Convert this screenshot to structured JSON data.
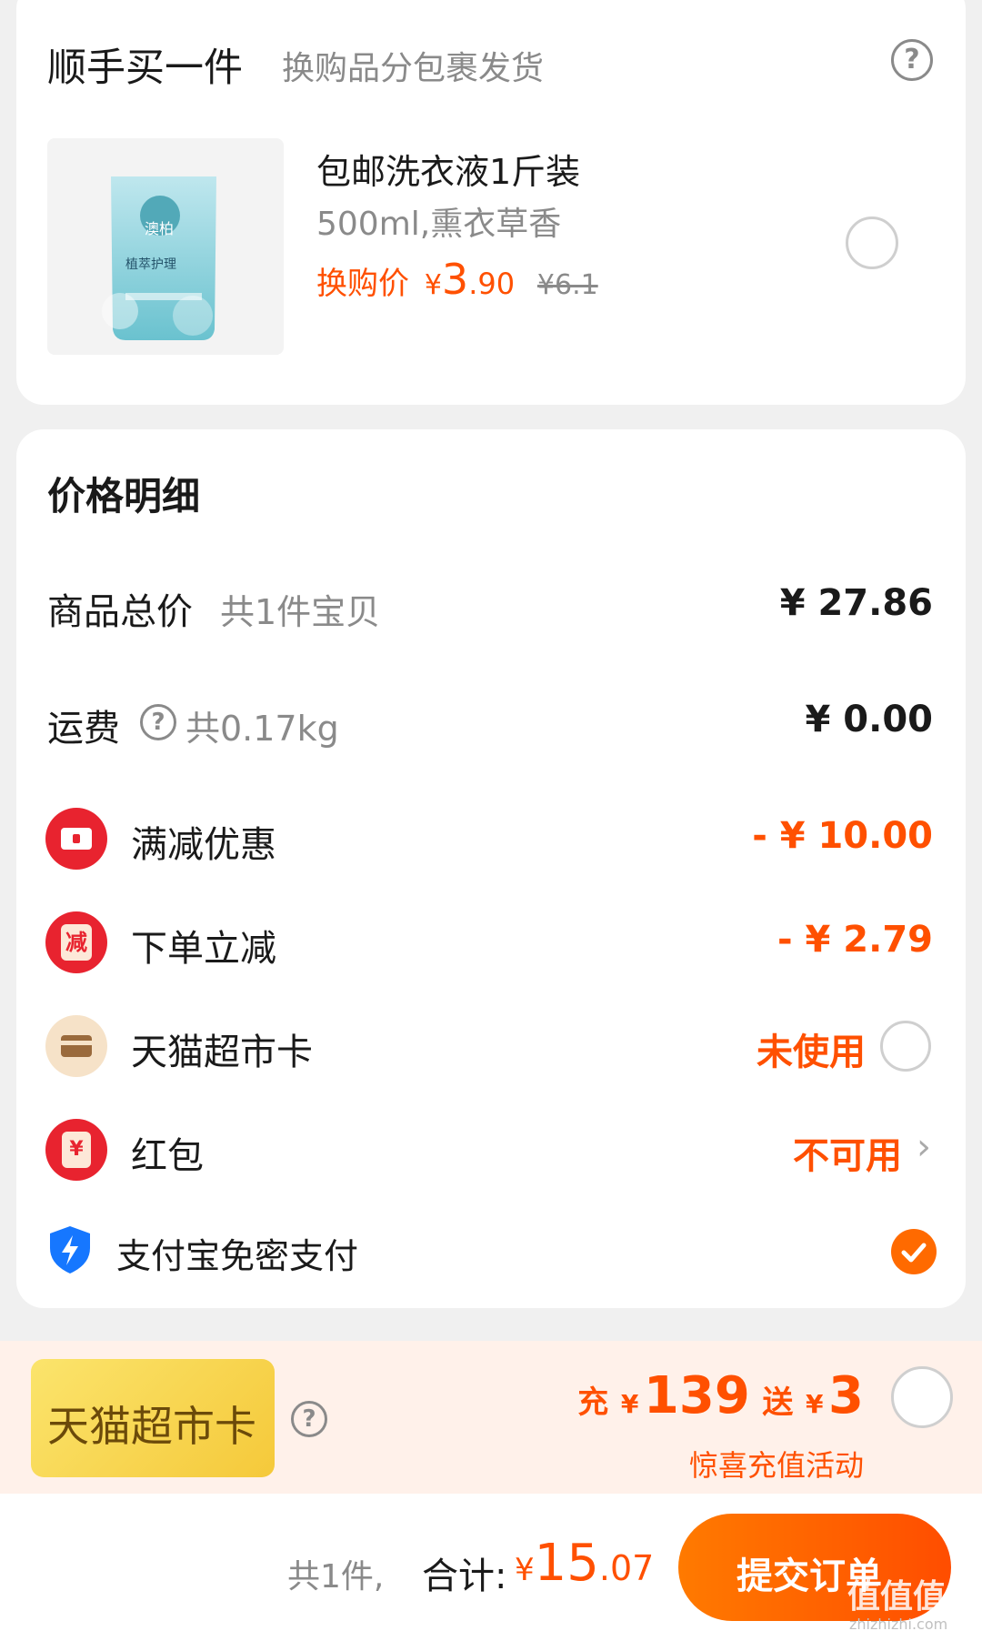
{
  "addon": {
    "title": "顺手买一件",
    "subtitle": "换购品分包裹发货",
    "help_icon": "question-circle-icon",
    "product": {
      "name": "包邮洗衣液1斤装",
      "spec": "500ml,熏衣草香",
      "price_label": "换购价",
      "currency": "¥",
      "price_int": "3",
      "price_dec": ".90",
      "original_price": "¥6.1",
      "image_brand": "澳柏",
      "image_text": "植萃护理"
    }
  },
  "price_detail": {
    "title": "价格明细",
    "rows": [
      {
        "label": "商品总价",
        "note": "共1件宝贝",
        "value": "¥ 27.86"
      },
      {
        "label": "运费",
        "note": "共0.17kg",
        "value": "¥ 0.00"
      }
    ],
    "discounts": [
      {
        "label": "满减优惠",
        "value": "- ¥ 10.00",
        "icon": "coupon-icon"
      },
      {
        "label": "下单立减",
        "value": "- ¥ 2.79",
        "icon": "instant-discount-icon",
        "icon_char": "减"
      },
      {
        "label": "天猫超市卡",
        "value": "未使用",
        "icon": "card-icon"
      },
      {
        "label": "红包",
        "value": "不可用",
        "icon": "red-packet-icon",
        "icon_char": "¥"
      }
    ],
    "alipay": {
      "label": "支付宝免密支付",
      "icon": "alipay-shield-icon",
      "checked": true
    }
  },
  "promo": {
    "card_label": "天猫超市卡",
    "charge_prefix": "充",
    "charge_amount": "139",
    "give_prefix": "送",
    "give_amount": "3",
    "currency": "¥",
    "subtitle": "惊喜充值活动"
  },
  "footer": {
    "count": "共1件,",
    "total_label": "合计:",
    "currency": "¥",
    "total_int": "15",
    "total_dec": ".07",
    "submit": "提交订单",
    "watermark": "值值值",
    "watermark_url": "zhizhizhi.com"
  },
  "colors": {
    "accent": "#ff5000",
    "red": "#e8232f",
    "gold": "#f7d34a"
  }
}
